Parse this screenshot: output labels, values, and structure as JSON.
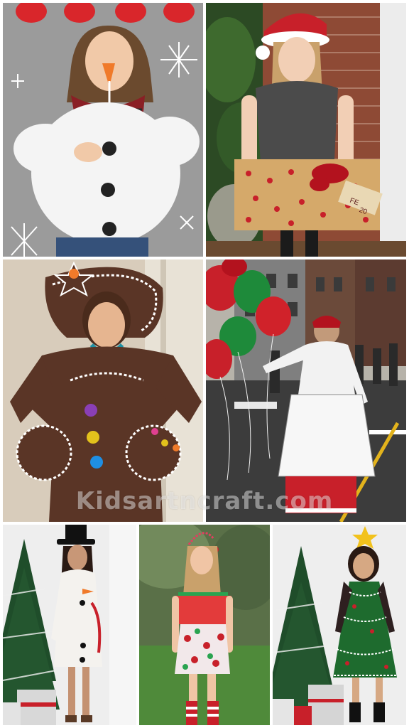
{
  "collage": {
    "photos": [
      {
        "subject": "snowman-costume"
      },
      {
        "subject": "gift-box-costume"
      },
      {
        "subject": "gingerbread-costume"
      },
      {
        "subject": "mrs-claus-parade-costume"
      },
      {
        "subject": "snowman-dress-costume"
      },
      {
        "subject": "christmas-sweater-dress-costume"
      },
      {
        "subject": "christmas-tree-costume"
      }
    ],
    "watermark": "Kidsartncraft.com",
    "sign_text": "FE\n20"
  },
  "colors": {
    "costume_red": "#c8202a",
    "costume_green": "#1e6b2e",
    "gingerbread_brown": "#5a3526",
    "background_gray": "#9a9a9a"
  }
}
